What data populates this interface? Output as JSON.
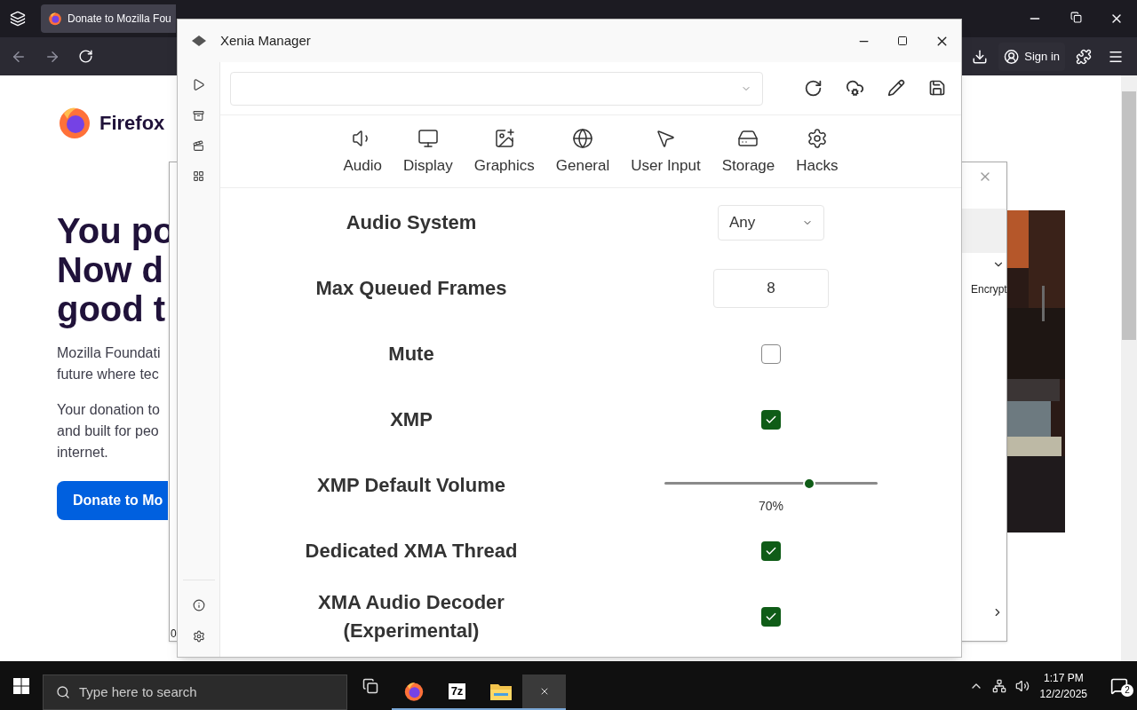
{
  "browser": {
    "tab": {
      "title": "Donate to Mozilla Fou"
    },
    "toolbar": {
      "sign_in": "Sign in"
    },
    "page": {
      "brand": "Firefox",
      "heading": [
        "You po",
        "Now d",
        "good t"
      ],
      "paragraphs": [
        [
          "Mozilla Foundati",
          "future where tec"
        ],
        [
          "Your donation to",
          "and built for peo",
          "internet."
        ]
      ],
      "donate_button": "Donate to Mo"
    }
  },
  "background_window": {
    "column_text": "Encrypt",
    "status_text": "0"
  },
  "xenia": {
    "window": {
      "title": "Xenia Manager"
    },
    "tabs": [
      {
        "label": "Audio"
      },
      {
        "label": "Display"
      },
      {
        "label": "Graphics"
      },
      {
        "label": "General"
      },
      {
        "label": "User Input"
      },
      {
        "label": "Storage"
      },
      {
        "label": "Hacks"
      }
    ],
    "settings": [
      {
        "label": "Audio System",
        "kind": "dropdown",
        "value": "Any"
      },
      {
        "label": "Max Queued Frames",
        "kind": "number",
        "value": "8"
      },
      {
        "label": "Mute",
        "kind": "checkbox",
        "checked": false
      },
      {
        "label": "XMP",
        "kind": "checkbox",
        "checked": true
      },
      {
        "label": "XMP Default Volume",
        "kind": "slider",
        "level": 0.68,
        "reading": "70%"
      },
      {
        "label": "Dedicated XMA Thread",
        "kind": "checkbox",
        "checked": true
      },
      {
        "label": "XMA Audio Decoder\n(Experimental)",
        "kind": "checkbox",
        "checked": true
      }
    ]
  },
  "taskbar": {
    "search_placeholder": "Type here to search",
    "apps": [
      {
        "kind": "firefox",
        "selected": false
      },
      {
        "kind": "archiver",
        "label": "7z",
        "selected": false
      },
      {
        "kind": "folder",
        "selected": false
      },
      {
        "kind": "xenia",
        "selected": true
      }
    ],
    "time": "1:17 PM",
    "date": "12/2/2025",
    "notifications": "2"
  }
}
